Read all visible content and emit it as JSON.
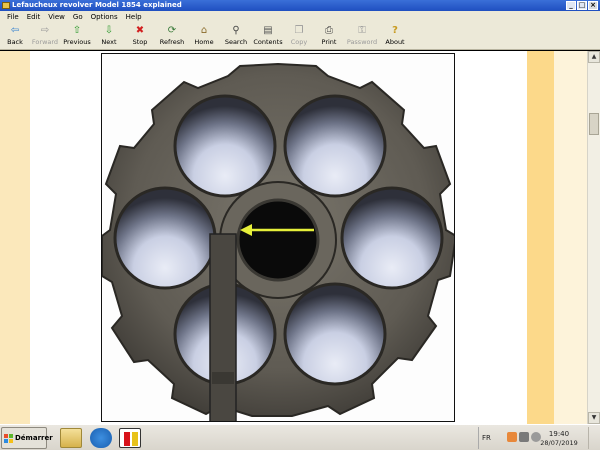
{
  "window": {
    "title": "Lefaucheux revolver Model 1854 explained",
    "controls": {
      "minimize": "_",
      "maximize": "□",
      "close": "×"
    }
  },
  "menu": [
    "File",
    "Edit",
    "View",
    "Go",
    "Options",
    "Help"
  ],
  "toolbar": [
    {
      "label": "Back",
      "icon": "back-arrow-icon",
      "glyph": "⇦",
      "color": "#2f7fd0",
      "enabled": true
    },
    {
      "label": "Forward",
      "icon": "forward-arrow-icon",
      "glyph": "⇨",
      "color": "#9a9a9a",
      "enabled": false
    },
    {
      "label": "Previous",
      "icon": "up-arrow-icon",
      "glyph": "⇧",
      "color": "#2e9a2e",
      "enabled": true
    },
    {
      "label": "Next",
      "icon": "down-arrow-icon",
      "glyph": "⇩",
      "color": "#2e9a2e",
      "enabled": true
    },
    {
      "label": "Stop",
      "icon": "stop-icon",
      "glyph": "✖",
      "color": "#d22020",
      "enabled": true
    },
    {
      "label": "Refresh",
      "icon": "refresh-icon",
      "glyph": "⟳",
      "color": "#3a7a3a",
      "enabled": true
    },
    {
      "label": "Home",
      "icon": "home-icon",
      "glyph": "⌂",
      "color": "#8a6a2a",
      "enabled": true
    },
    {
      "label": "Search",
      "icon": "search-icon",
      "glyph": "⚲",
      "color": "#444444",
      "enabled": true
    },
    {
      "label": "Contents",
      "icon": "contents-icon",
      "glyph": "▤",
      "color": "#555555",
      "enabled": true
    },
    {
      "label": "Copy",
      "icon": "copy-icon",
      "glyph": "❐",
      "color": "#9a9a9a",
      "enabled": false
    },
    {
      "label": "Print",
      "icon": "print-icon",
      "glyph": "⎙",
      "color": "#444444",
      "enabled": true
    },
    {
      "label": "Password",
      "icon": "key-icon",
      "glyph": "⚿",
      "color": "#9a9a9a",
      "enabled": false
    },
    {
      "label": "About",
      "icon": "about-icon",
      "glyph": "?",
      "color": "#c89a20",
      "enabled": true
    }
  ],
  "taskbar": {
    "start_label": "Démarrer",
    "language": "FR",
    "time": "19:40",
    "date": "28/07/2019"
  },
  "colors": {
    "content_left": "#fbe8bb",
    "content_right": "#fcd98a",
    "titlebar": "#2a5fcf"
  }
}
